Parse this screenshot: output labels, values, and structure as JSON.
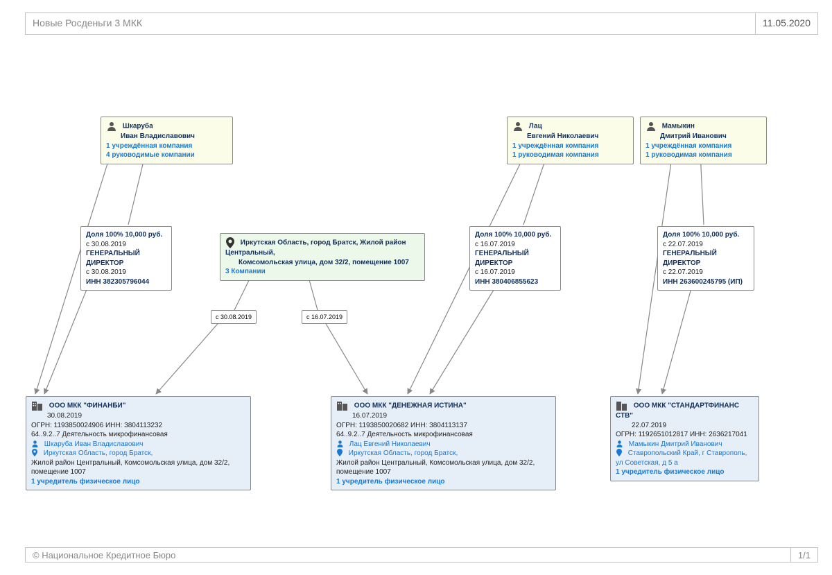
{
  "header": {
    "title": "Новые Росденьги 3 МКК",
    "date": "11.05.2020"
  },
  "footer": {
    "copyright": "© Национальное Кредитное Бюро",
    "page": "1/1"
  },
  "persons": {
    "p1": {
      "last": "Шкаруба",
      "first": "Иван Владиславович",
      "founded": "1 учреждённая компания",
      "managed": "4 руководимые компании"
    },
    "p2": {
      "last": "Лац",
      "first": "Евгений Николаевич",
      "founded": "1 учреждённая компания",
      "managed": "1 руководимая компания"
    },
    "p3": {
      "last": "Мамыкин",
      "first": "Дмитрий Иванович",
      "founded": "1 учреждённая компания",
      "managed": "1 руководимая компания"
    }
  },
  "location": {
    "l1": {
      "line1": "Иркутская Область, город Братск, Жилой район Центральный,",
      "line2": "Комсомольская улица, дом 32/2, помещение 1007",
      "companies": "3 Компании"
    }
  },
  "rels": {
    "r1": {
      "share": "Доля 100%  10,000 руб.",
      "share_date": "с 30.08.2019",
      "role": "ГЕНЕРАЛЬНЫЙ ДИРЕКТОР",
      "role_date": "с 30.08.2019",
      "inn": "ИНН 382305796044"
    },
    "r2": {
      "share": "Доля 100%  10,000 руб.",
      "share_date": "с 16.07.2019",
      "role": "ГЕНЕРАЛЬНЫЙ ДИРЕКТОР",
      "role_date": "с 16.07.2019",
      "inn": "ИНН 380406855623"
    },
    "r3": {
      "share": "Доля 100%  10,000 руб.",
      "share_date": "с 22.07.2019",
      "role": "ГЕНЕРАЛЬНЫЙ ДИРЕКТОР",
      "role_date": "с 22.07.2019",
      "inn": "ИНН 263600245795 (ИП)"
    }
  },
  "edge_labels": {
    "e1": "с 30.08.2019",
    "e2": "с 16.07.2019"
  },
  "companies": {
    "c1": {
      "name": "ООО МКК \"ФИНАНБИ\"",
      "date": "30.08.2019",
      "ogrn_inn": "ОГРН: 1193850024906    ИНН: 3804113232",
      "activity": "64..9.2..7 Деятельность микрофинансовая",
      "director": "Шкаруба Иван Владиславович",
      "addr": "Иркутская Область, город Братск,",
      "addr2": "Жилой район Центральный, Комсомольская улица, дом 32/2, помещение 1007",
      "founder": "1 учредитель физическое лицо"
    },
    "c2": {
      "name": "ООО МКК \"ДЕНЕЖНАЯ ИСТИНА\"",
      "date": "16.07.2019",
      "ogrn_inn": "ОГРН: 1193850020682    ИНН: 3804113137",
      "activity": "64..9.2..7 Деятельность микрофинансовая",
      "director": "Лац Евгений Николаевич",
      "addr": "Иркутская Область, город Братск,",
      "addr2": "Жилой район Центральный, Комсомольская улица, дом 32/2, помещение 1007",
      "founder": "1 учредитель физическое лицо"
    },
    "c3": {
      "name": "ООО МКК \"СТАНДАРТФИНАНС СТВ\"",
      "date": "22.07.2019",
      "ogrn_inn": "ОГРН: 1192651012817    ИНН: 2636217041",
      "director": "Мамыкин Дмитрий Иванович",
      "addr": "Ставропольский Край, г Ставрополь,",
      "addr2": "ул Советская, д 5 а",
      "founder": "1 учредитель физическое лицо"
    }
  }
}
